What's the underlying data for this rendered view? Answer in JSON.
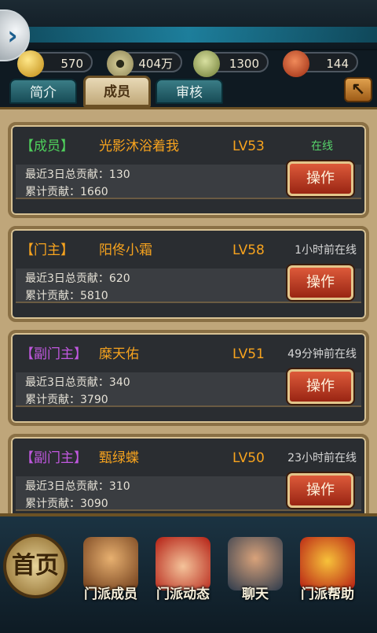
{
  "resources": [
    {
      "icon": "gold-ingot-icon",
      "value": "570"
    },
    {
      "icon": "copper-coin-icon",
      "value": "404万"
    },
    {
      "icon": "jade-icon",
      "value": "1300"
    },
    {
      "icon": "stamina-token-icon",
      "value": "144"
    }
  ],
  "tabs": [
    "简介",
    "成员",
    "审核"
  ],
  "active_tab": "成员",
  "up_button_icon": "arrow-up-left-icon",
  "members": [
    {
      "role": "【成员】",
      "role_color": "#4fd05c",
      "name": "光影沐浴着我",
      "level": "LV53",
      "status": "在线",
      "recent_label": "最近3日总贡献：",
      "recent": "130",
      "total_label": "累计贡献：",
      "total": "1660",
      "action": "操作"
    },
    {
      "role": "【门主】",
      "role_color": "#f7a31e",
      "name": "阳佟小霜",
      "level": "LV58",
      "status": "1小时前在线",
      "recent_label": "最近3日总贡献：",
      "recent": "620",
      "total_label": "累计贡献：",
      "total": "5810",
      "action": "操作"
    },
    {
      "role": "【副门主】",
      "role_color": "#c158e0",
      "name": "糜天佑",
      "level": "LV51",
      "status": "49分钟前在线",
      "recent_label": "最近3日总贡献：",
      "recent": "340",
      "total_label": "累计贡献：",
      "total": "3790",
      "action": "操作"
    },
    {
      "role": "【副门主】",
      "role_color": "#c158e0",
      "name": "甄绿蝶",
      "level": "LV50",
      "status": "23小时前在线",
      "recent_label": "最近3日总贡献：",
      "recent": "310",
      "total_label": "累计贡献：",
      "total": "3090",
      "action": "操作"
    }
  ],
  "bottom_nav": {
    "home_label": "首页",
    "items": [
      {
        "label": "门派成员",
        "icon": "members-portrait-icon"
      },
      {
        "label": "门派动态",
        "icon": "news-banner-icon"
      },
      {
        "label": "聊天",
        "icon": "chat-character-icon"
      },
      {
        "label": "门派帮助",
        "icon": "help-banner-icon"
      }
    ]
  }
}
